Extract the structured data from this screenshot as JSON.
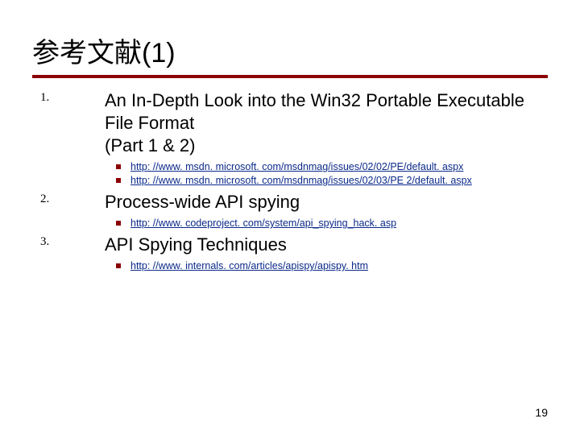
{
  "title": "参考文献(1)",
  "page_number": "19",
  "colors": {
    "rule": "#8b0000",
    "link": "#0b2a8a"
  },
  "items": [
    {
      "num": "1.",
      "title": "An In-Depth Look into the Win32 Portable Executable File Format\n(Part 1 & 2)",
      "links": [
        "http: //www. msdn. microsoft. com/msdnmag/issues/02/02/PE/default. aspx",
        "http: //www. msdn. microsoft. com/msdnmag/issues/02/03/PE 2/default. aspx"
      ]
    },
    {
      "num": "2.",
      "title": "Process-wide API spying",
      "links": [
        "http: //www. codeproject. com/system/api_spying_hack. asp"
      ]
    },
    {
      "num": "3.",
      "title": "API Spying Techniques",
      "links": [
        "http: //www. internals. com/articles/apispy/apispy. htm"
      ]
    }
  ]
}
